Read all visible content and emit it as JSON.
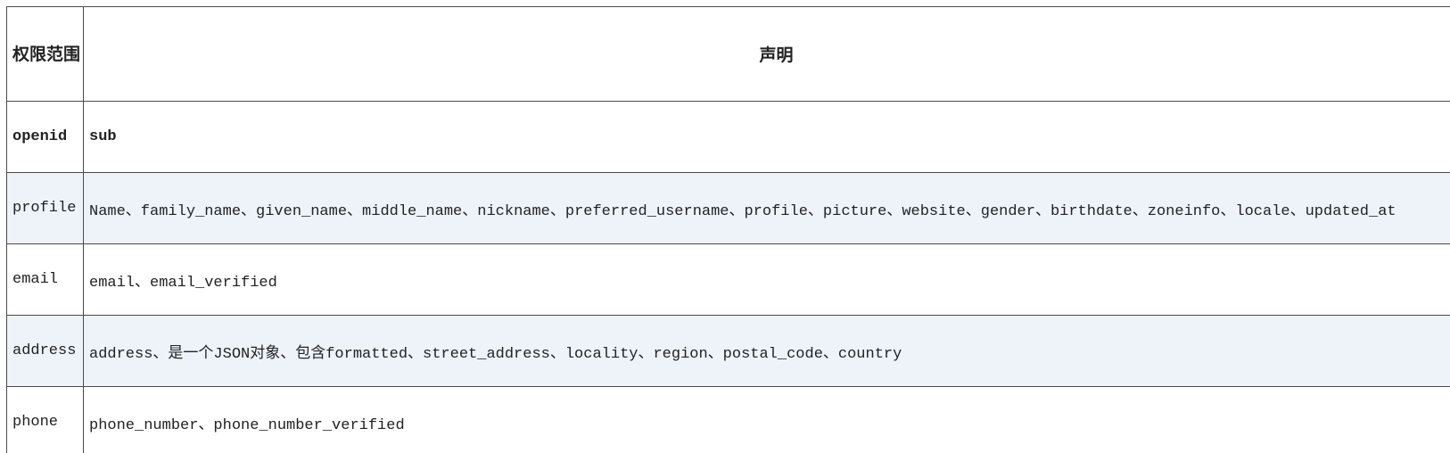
{
  "table": {
    "headers": {
      "scope": "权限范围",
      "claims": "声明"
    },
    "rows": [
      {
        "scope": "openid",
        "claims": "sub"
      },
      {
        "scope": "profile",
        "claims": "Name、family_name、given_name、middle_name、nickname、preferred_username、profile、picture、website、gender、birthdate、zoneinfo、locale、updated_at"
      },
      {
        "scope": "email",
        "claims": "email、email_verified"
      },
      {
        "scope": "address",
        "claims": "address、是一个JSON对象、包含formatted、street_address、locality、region、postal_code、country"
      },
      {
        "scope": "phone",
        "claims": "phone_number、phone_number_verified"
      }
    ]
  }
}
